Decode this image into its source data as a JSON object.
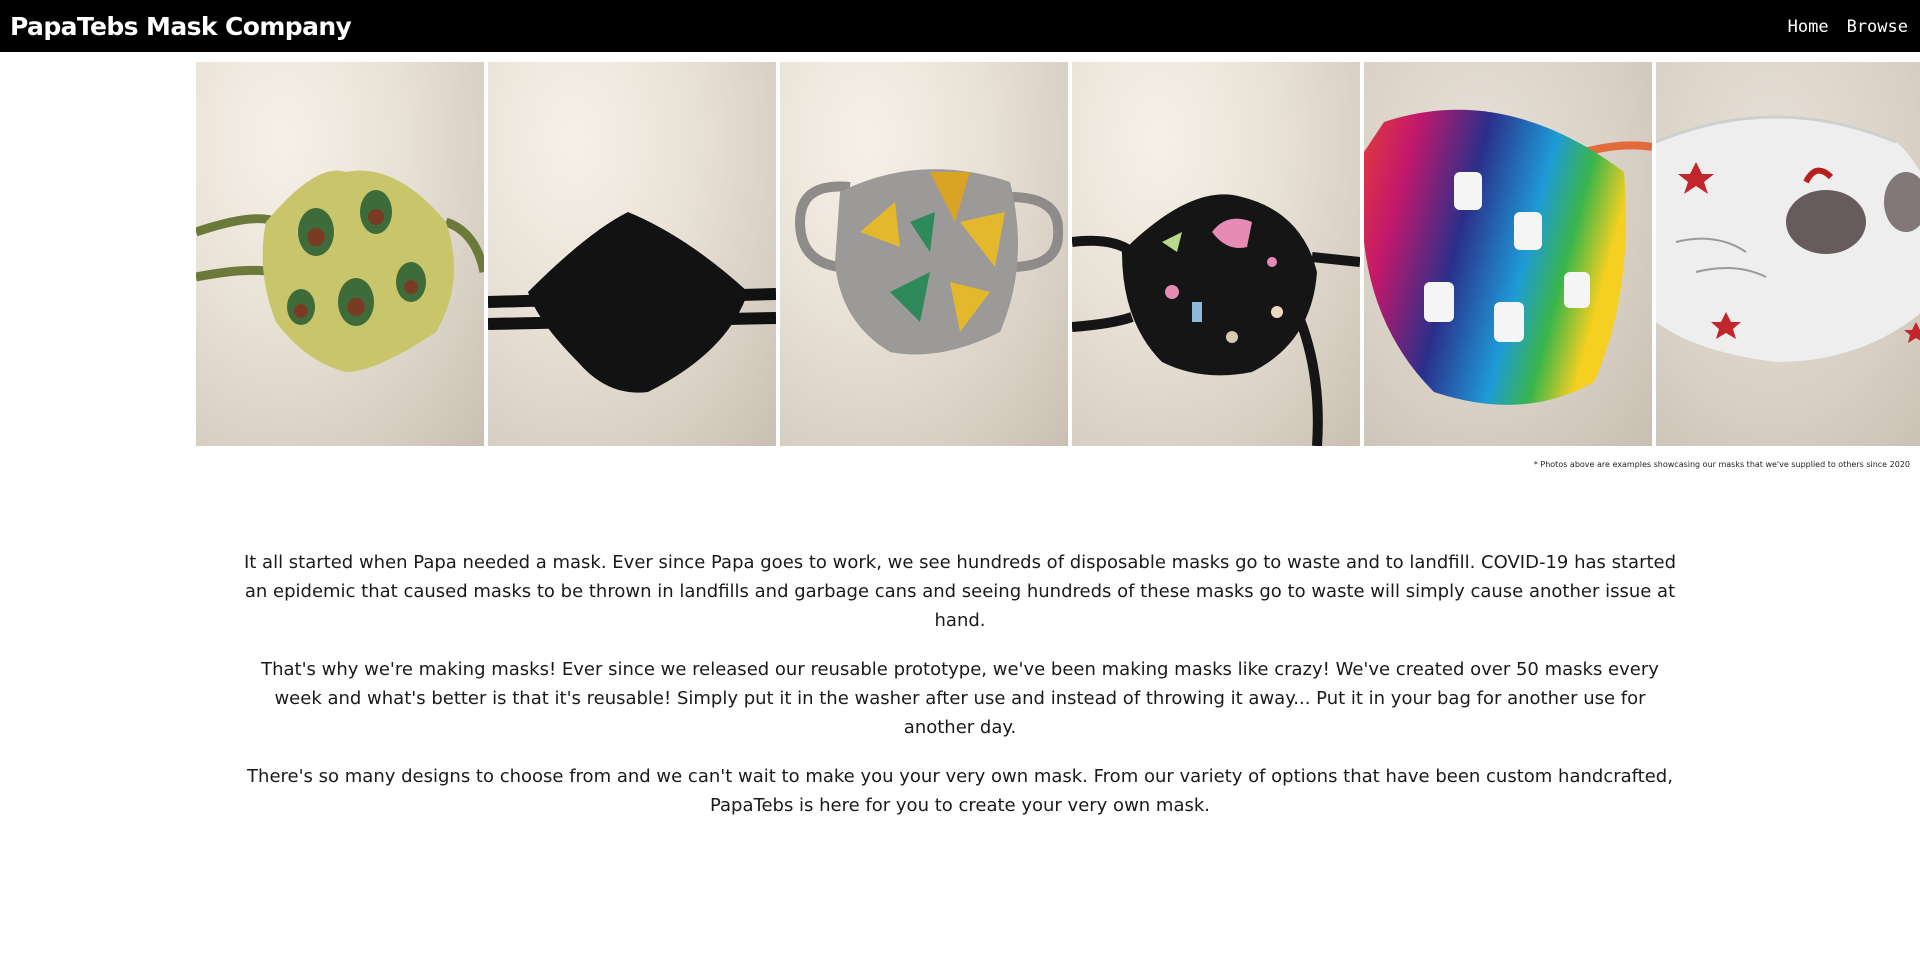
{
  "header": {
    "brand": "PapaTebs Mask Company",
    "nav": [
      {
        "label": "Home"
      },
      {
        "label": "Browse"
      }
    ]
  },
  "gallery": {
    "photos": [
      {
        "subject": "avocado print mask on bedsheet",
        "fabric": "#c8c56a",
        "accent": "#3e6b3a",
        "bg": "sheet"
      },
      {
        "subject": "black mask on bedsheet",
        "fabric": "#121212",
        "accent": "#2a2a2a",
        "bg": "sheet"
      },
      {
        "subject": "taco print mask on bedsheet",
        "fabric": "#9c9a98",
        "accent": "#e3b82c",
        "bg": "sheet"
      },
      {
        "subject": "sewing print black mask on bedsheet",
        "fabric": "#151515",
        "accent": "#e58bb5",
        "bg": "sheet"
      },
      {
        "subject": "rainbow sign language mask on counter",
        "fabric": "#3a4bb5",
        "accent": "#e23b3b",
        "bg": "counter"
      },
      {
        "subject": "white rooster print mask on counter",
        "fabric": "#efefef",
        "accent": "#3a2a2a",
        "bg": "counter"
      }
    ],
    "caption": "* Photos above are examples showcasing our masks that we've supplied to others since 2020"
  },
  "story": {
    "paragraphs": [
      "It all started when Papa needed a mask. Ever since Papa goes to work, we see hundreds of disposable masks go to waste and to landfill. COVID-19 has started an epidemic that caused masks to be thrown in landfills and garbage cans and seeing hundreds of these masks go to waste will simply cause another issue at hand.",
      "That's why we're making masks! Ever since we released our reusable prototype, we've been making masks like crazy! We've created over 50 masks every week and what's better is that it's reusable! Simply put it in the washer after use and instead of throwing it away... Put it in your bag for another use for another day.",
      "There's so many designs to choose from and we can't wait to make you your very own mask. From our variety of options that have been custom handcrafted, PapaTebs is here for you to create your very own mask."
    ]
  },
  "colors": {
    "header_bg": "#000000",
    "header_text": "#ffffff",
    "page_bg": "#ffffff",
    "body_text": "#1a1a1a"
  }
}
